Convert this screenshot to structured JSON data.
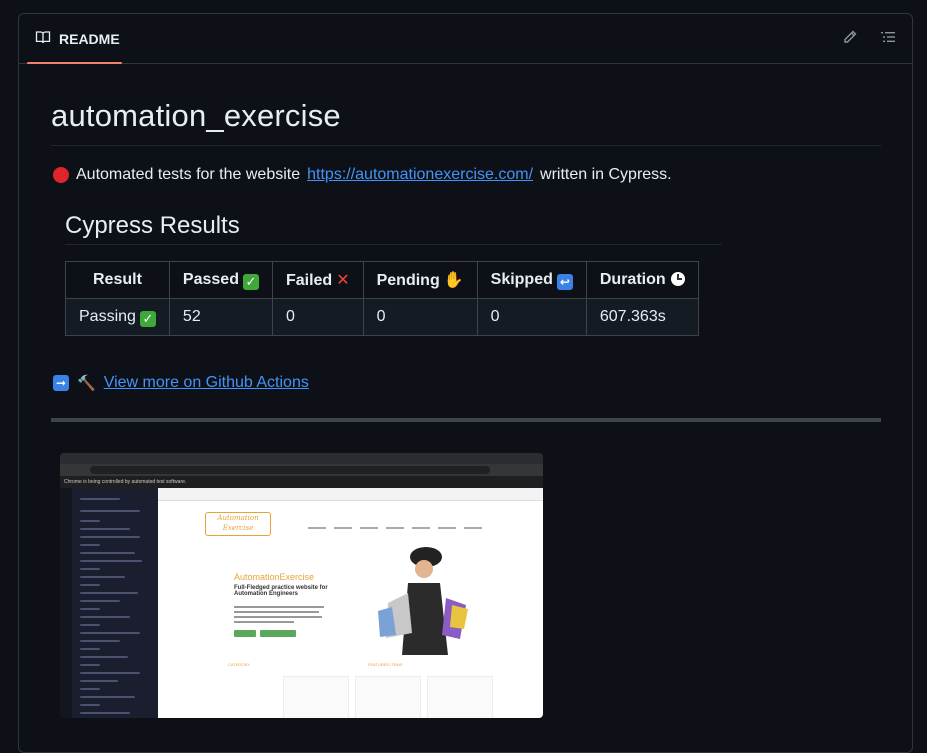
{
  "header": {
    "tab_label": "README",
    "tab_icon": "book-icon",
    "edit_icon": "pencil-icon",
    "outline_icon": "list-icon"
  },
  "readme": {
    "title": "automation_exercise",
    "description_prefix": "Automated tests for the website",
    "description_link": "https://automationexercise.com/",
    "description_suffix": "written in Cypress.",
    "results_heading": "Cypress Results",
    "table": {
      "headers": [
        "Result",
        "Passed",
        "Failed",
        "Pending",
        "Skipped",
        "Duration"
      ],
      "row": [
        "Passing",
        "52",
        "0",
        "0",
        "0",
        "607.363s"
      ]
    },
    "more_link": "View more on Github Actions"
  },
  "screenshot": {
    "warning": "Chrome is being controlled by automated test software.",
    "site_brand": "AutomationExercise",
    "site_subtitle": "Full-Fledged practice website for Automation Engineers",
    "logo_text": "Automation Exercise",
    "category_label": "CATEGORY",
    "featured_label": "FEATURES ITEMS"
  },
  "colors": {
    "background": "#0d1117",
    "border": "#30363d",
    "link": "#4493f8",
    "tab_underline": "#f78166"
  }
}
